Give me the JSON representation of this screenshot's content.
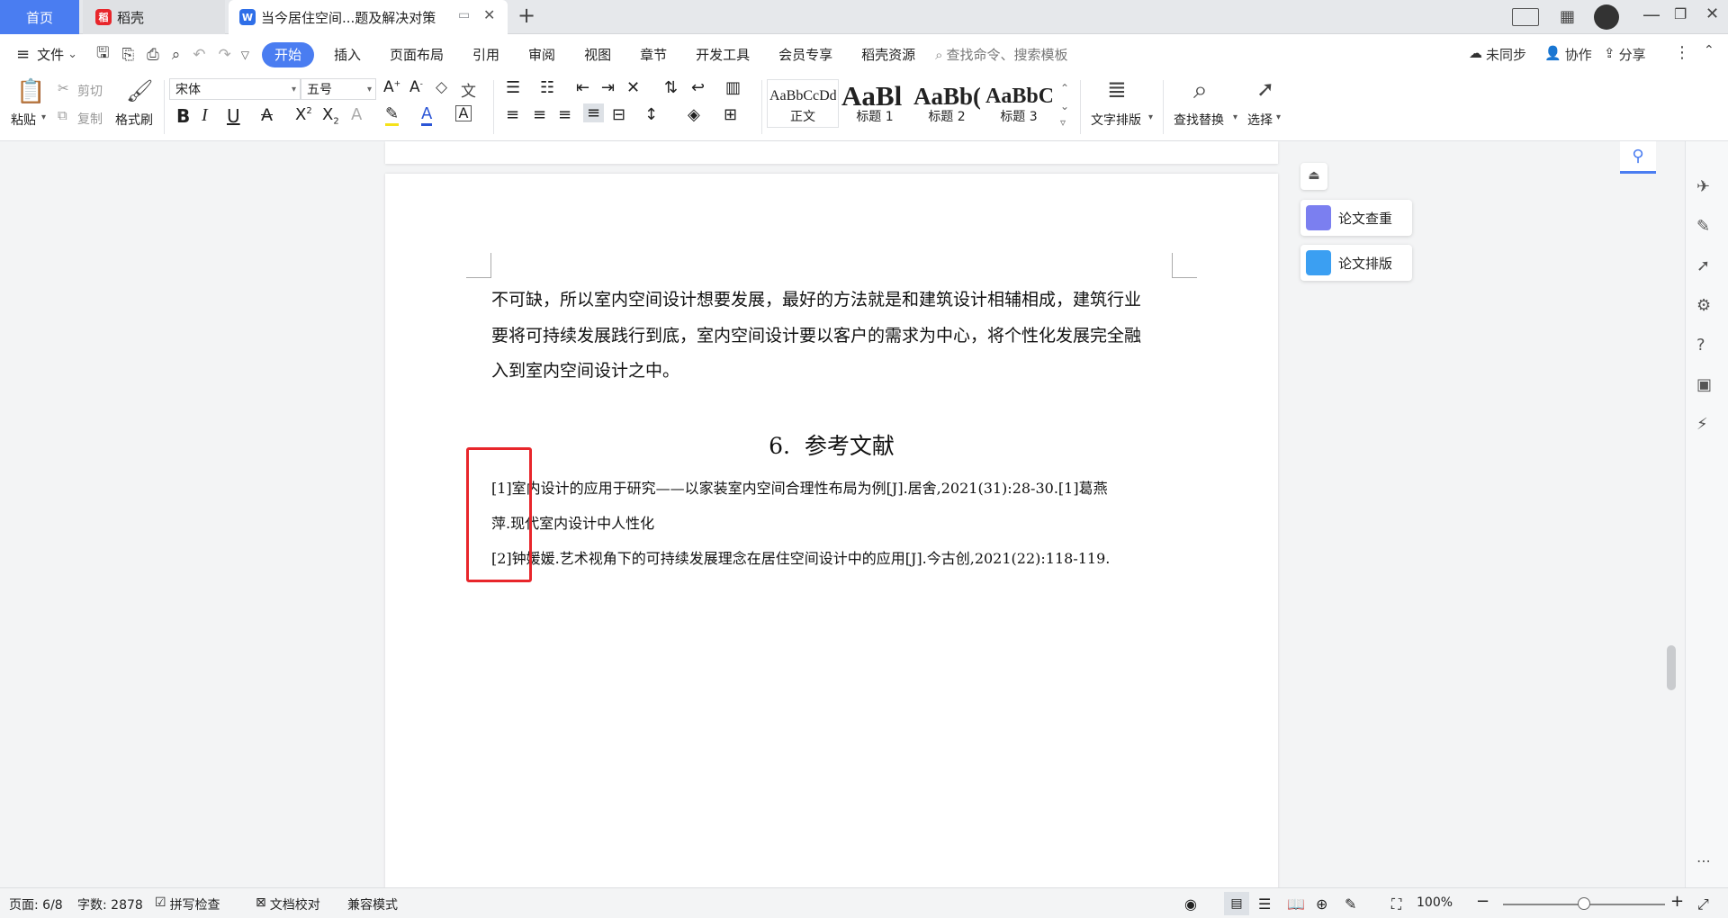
{
  "tabs": {
    "home": "首页",
    "daoke": "稻壳",
    "doc": "当今居住空间...题及解决对策",
    "new_tab": "+"
  },
  "menu": {
    "file": "文件",
    "items": [
      "开始",
      "插入",
      "页面布局",
      "引用",
      "审阅",
      "视图",
      "章节",
      "开发工具",
      "会员专享",
      "稻壳资源"
    ],
    "active": "开始",
    "search_placeholder": "查找命令、搜索模板",
    "sync": "未同步",
    "collab": "协作",
    "share": "分享"
  },
  "toolbar": {
    "paste": "粘贴",
    "cut": "剪切",
    "copy": "复制",
    "format_painter": "格式刷",
    "font_name": "宋体",
    "font_size": "五号",
    "styles": [
      {
        "sample": "AaBbCcDd",
        "label": "正文"
      },
      {
        "sample": "AaBl",
        "label": "标题 1"
      },
      {
        "sample": "AaBb(",
        "label": "标题 2"
      },
      {
        "sample": "AaBbC",
        "label": "标题 3"
      }
    ],
    "text_layout": "文字排版",
    "find_replace": "查找替换",
    "select": "选择"
  },
  "document": {
    "body_lines": [
      "不可缺，所以室内空间设计想要发展，最好的方法就是和建筑设计相辅相成，建筑行业",
      "要将可持续发展践行到底，室内空间设计要以客户的需求为中心，将个性化发展完全融",
      "入到室内空间设计之中。"
    ],
    "heading": "6.  参考文献",
    "references": [
      "[1]室内设计的应用于研究——以家装室内空间合理性布局为例[J].居舍,2021(31):28-30.[1]葛燕",
      "萍.现代室内设计中人性化",
      "[2]钟媛媛.艺术视角下的可持续发展理念在居住空间设计中的应用[J].今古创,2021(22):118-119."
    ]
  },
  "side_panel": {
    "check": "论文查重",
    "layout": "论文排版"
  },
  "status": {
    "page": "页面: 6/8",
    "words": "字数: 2878",
    "spell": "拼写检查",
    "proof": "文档校对",
    "compat": "兼容模式",
    "zoom": "100%",
    "zoom_level": 0.5
  },
  "colors": {
    "accent": "#4a7df1",
    "highlight_box": "#e8262b"
  }
}
